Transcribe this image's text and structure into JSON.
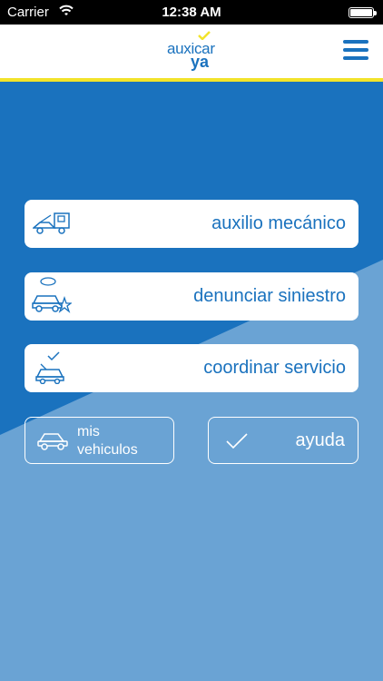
{
  "status_bar": {
    "carrier": "Carrier",
    "time": "12:38 AM"
  },
  "header": {
    "logo_line1": "auxicar",
    "logo_line2": "ya"
  },
  "menu": {
    "auxilio_label": "auxilio mecánico",
    "siniestro_label": "denunciar siniestro",
    "servicio_label": "coordinar servicio",
    "vehiculos_label_line1": "mis",
    "vehiculos_label_line2": "vehiculos",
    "ayuda_label": "ayuda"
  },
  "colors": {
    "brand_blue": "#1a72be",
    "background_light": "#6aa3d4",
    "accent_yellow": "#f2e32b"
  },
  "icons": [
    "wifi-icon",
    "battery-icon",
    "hamburger-menu-icon",
    "tow-truck-icon",
    "car-crash-icon",
    "car-service-icon",
    "car-icon",
    "check-icon"
  ]
}
